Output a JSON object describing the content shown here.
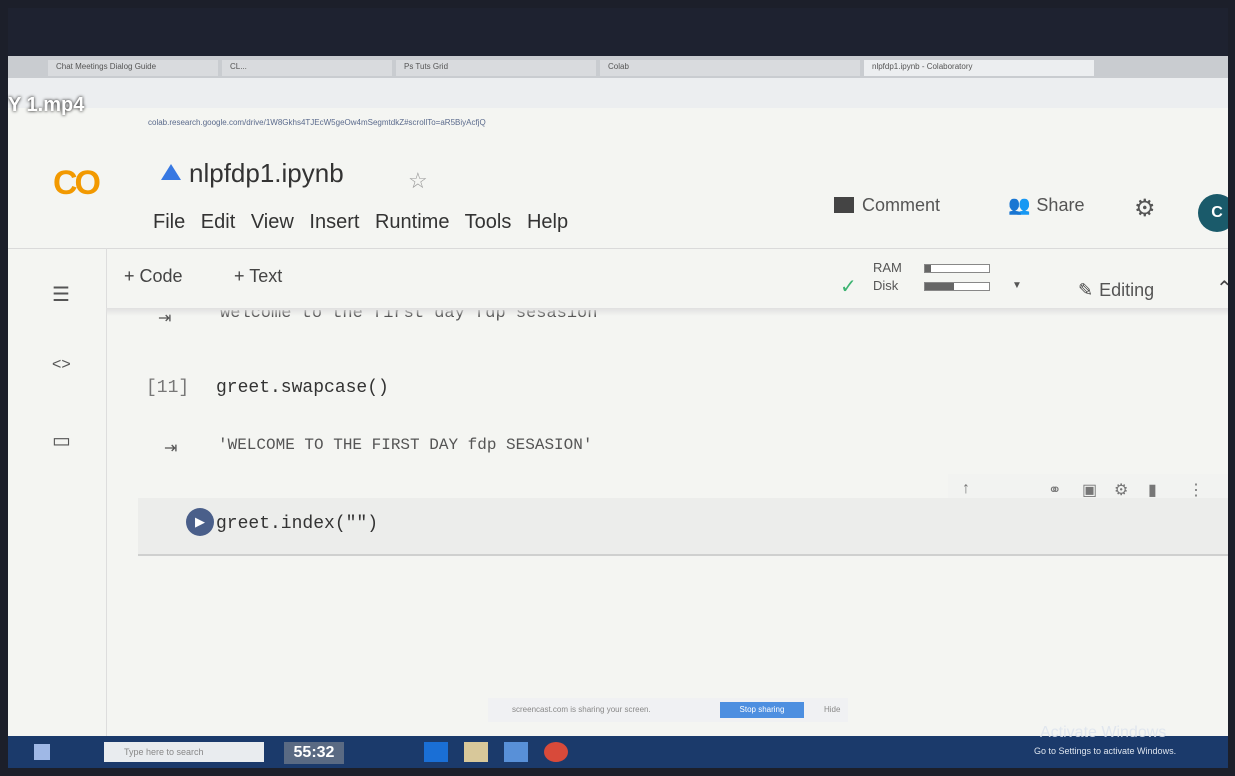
{
  "video": {
    "title": "Y 1.mp4",
    "timestamp": "55:32"
  },
  "browser": {
    "tabs": [
      "Chat Meetings Dialog Guide",
      "CL...",
      "Ps Tuts Grid",
      "Colab",
      "nlpfdp1.ipynb - Colaboratory"
    ],
    "url": "colab.research.google.com/drive/1W8Gkhs4TJEcW5geOw4mSegmtdkZ#scrollTo=aR5BiyAcfjQ"
  },
  "colab": {
    "logo": "CO",
    "notebook_title": "nlpfdp1.ipynb",
    "menu": [
      "File",
      "Edit",
      "View",
      "Insert",
      "Runtime",
      "Tools",
      "Help"
    ],
    "comment_label": "Comment",
    "share_label": "Share",
    "avatar_letter": "C",
    "toolbar": {
      "add_code": "+ Code",
      "add_text": "+ Text",
      "editing_label": "Editing"
    },
    "resources": {
      "ram_label": "RAM",
      "disk_label": "Disk",
      "ram_usage": 0.1,
      "disk_usage": 0.45
    }
  },
  "cells": {
    "prev_output": "welcome to the first day fdp sesasion",
    "cell1": {
      "exec_count": "[11]",
      "code": "greet.swapcase()",
      "output": "'WELCOME TO THE FIRST DAY fdp SESASION'"
    },
    "cell2": {
      "code": "greet.index(\"\")"
    }
  },
  "screen_share": {
    "message": "screencast.com is sharing your screen.",
    "stop_label": "Stop sharing",
    "hide_label": "Hide"
  },
  "taskbar": {
    "search_placeholder": "Type here to search"
  },
  "watermark": {
    "title": "Activate Windows",
    "subtitle": "Go to Settings to activate Windows."
  },
  "colors": {
    "colab_orange": "#f29900",
    "run_button": "#4a5f8a",
    "taskbar": "#1b3a6b"
  }
}
